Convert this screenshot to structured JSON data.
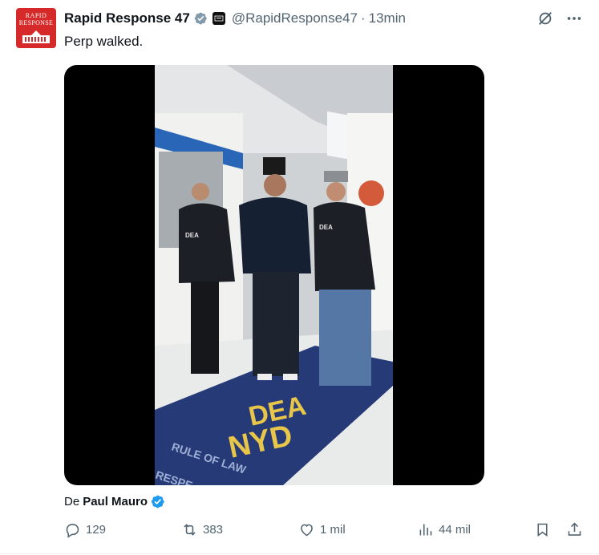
{
  "post": {
    "author_name": "Rapid Response 47",
    "handle": "@RapidResponse47",
    "separator": "·",
    "time": "13min",
    "text": "Perp walked.",
    "avatar_line1": "RAPID",
    "avatar_line2": "RESPONSE",
    "attribution_prefix": "De",
    "attribution_name": "Paul Mauro",
    "video_floor_text1": "DEA",
    "video_floor_text2": "NYD",
    "video_floor_text3": "RULE OF LAW",
    "video_floor_text4": "RESPE",
    "jacket_label": "DEA"
  },
  "actions": {
    "replies": "129",
    "reposts": "383",
    "likes": "1 mil",
    "views": "44 mil"
  },
  "colors": {
    "brand_red": "#d62a2a",
    "verified_blue": "#1d9bf0",
    "muted": "#536471",
    "text": "#0f1419"
  },
  "icons": [
    "verified-badge-icon",
    "affiliate-badge-icon",
    "grok-icon",
    "more-icon",
    "reply-icon",
    "repost-icon",
    "like-icon",
    "views-icon",
    "bookmark-icon",
    "share-icon"
  ]
}
